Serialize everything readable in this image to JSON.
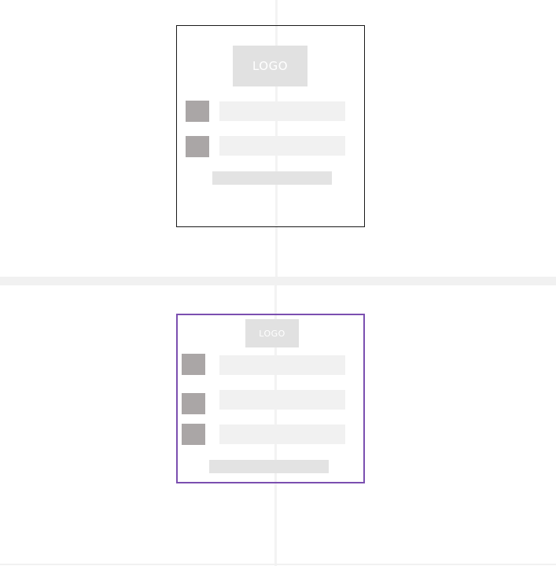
{
  "wireframes": {
    "card_a": {
      "logo_text": "LOGO",
      "field_count": 2
    },
    "card_b": {
      "logo_text": "LOGO",
      "field_count": 3
    }
  },
  "colors": {
    "card_a_border": "#1a1a1a",
    "card_b_border": "#7b4fb0",
    "logo_fill": "#e1e1e1",
    "icon_fill": "#aaa6a6",
    "field_fill": "#f1f1f1",
    "button_fill": "#e3e3e3"
  },
  "icons": [
    "field-icon-placeholder"
  ]
}
